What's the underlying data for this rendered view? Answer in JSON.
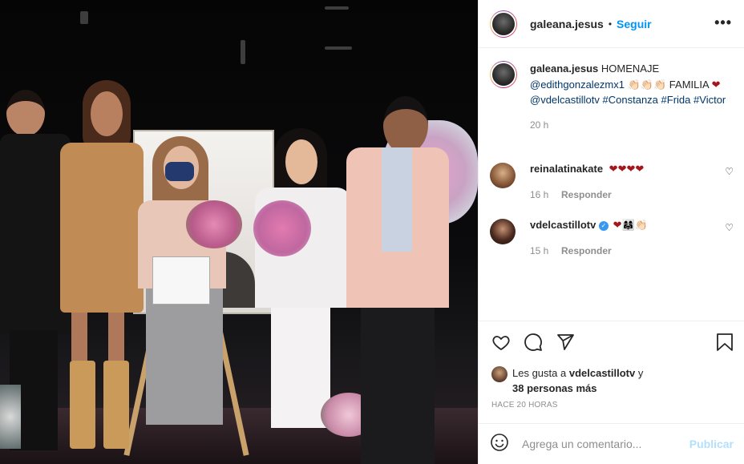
{
  "colors": {
    "accent": "#0095f6",
    "link": "#00376b",
    "muted": "#8e8e8e",
    "heart": "#a3161a"
  },
  "post": {
    "author": "galeana.jesus",
    "follow_label": "Seguir",
    "more_icon": "more-icon"
  },
  "caption": {
    "author": "galeana.jesus",
    "text_1": "HOMENAJE",
    "mention_1": "@edithgonzalezmx1",
    "hands_emoji": "👏🏻👏🏻👏🏻",
    "text_2": "FAMILIA",
    "heart_emoji": "❤",
    "mention_2": "@vdelcastillotv",
    "tag_1": "#Constanza",
    "tag_2": "#Frida",
    "tag_3": "#Victor",
    "time": "20 h"
  },
  "comments": [
    {
      "user": "reinalatinakate",
      "text": "❤❤❤❤",
      "time": "16 h",
      "reply_label": "Responder"
    },
    {
      "user": "vdelcastillotv",
      "verified_mark": "✓",
      "text": "❤👩‍👩‍👧👏🏻",
      "time": "15 h",
      "reply_label": "Responder"
    }
  ],
  "likes": {
    "prefix": "Les gusta a",
    "user": "vdelcastillotv",
    "conjunction": "y",
    "others": "38 personas más"
  },
  "timestamp": "HACE 20 HORAS",
  "add_comment": {
    "emoji_icon": "smiley-icon",
    "placeholder": "Agrega un comentario...",
    "publish_label": "Publicar"
  }
}
